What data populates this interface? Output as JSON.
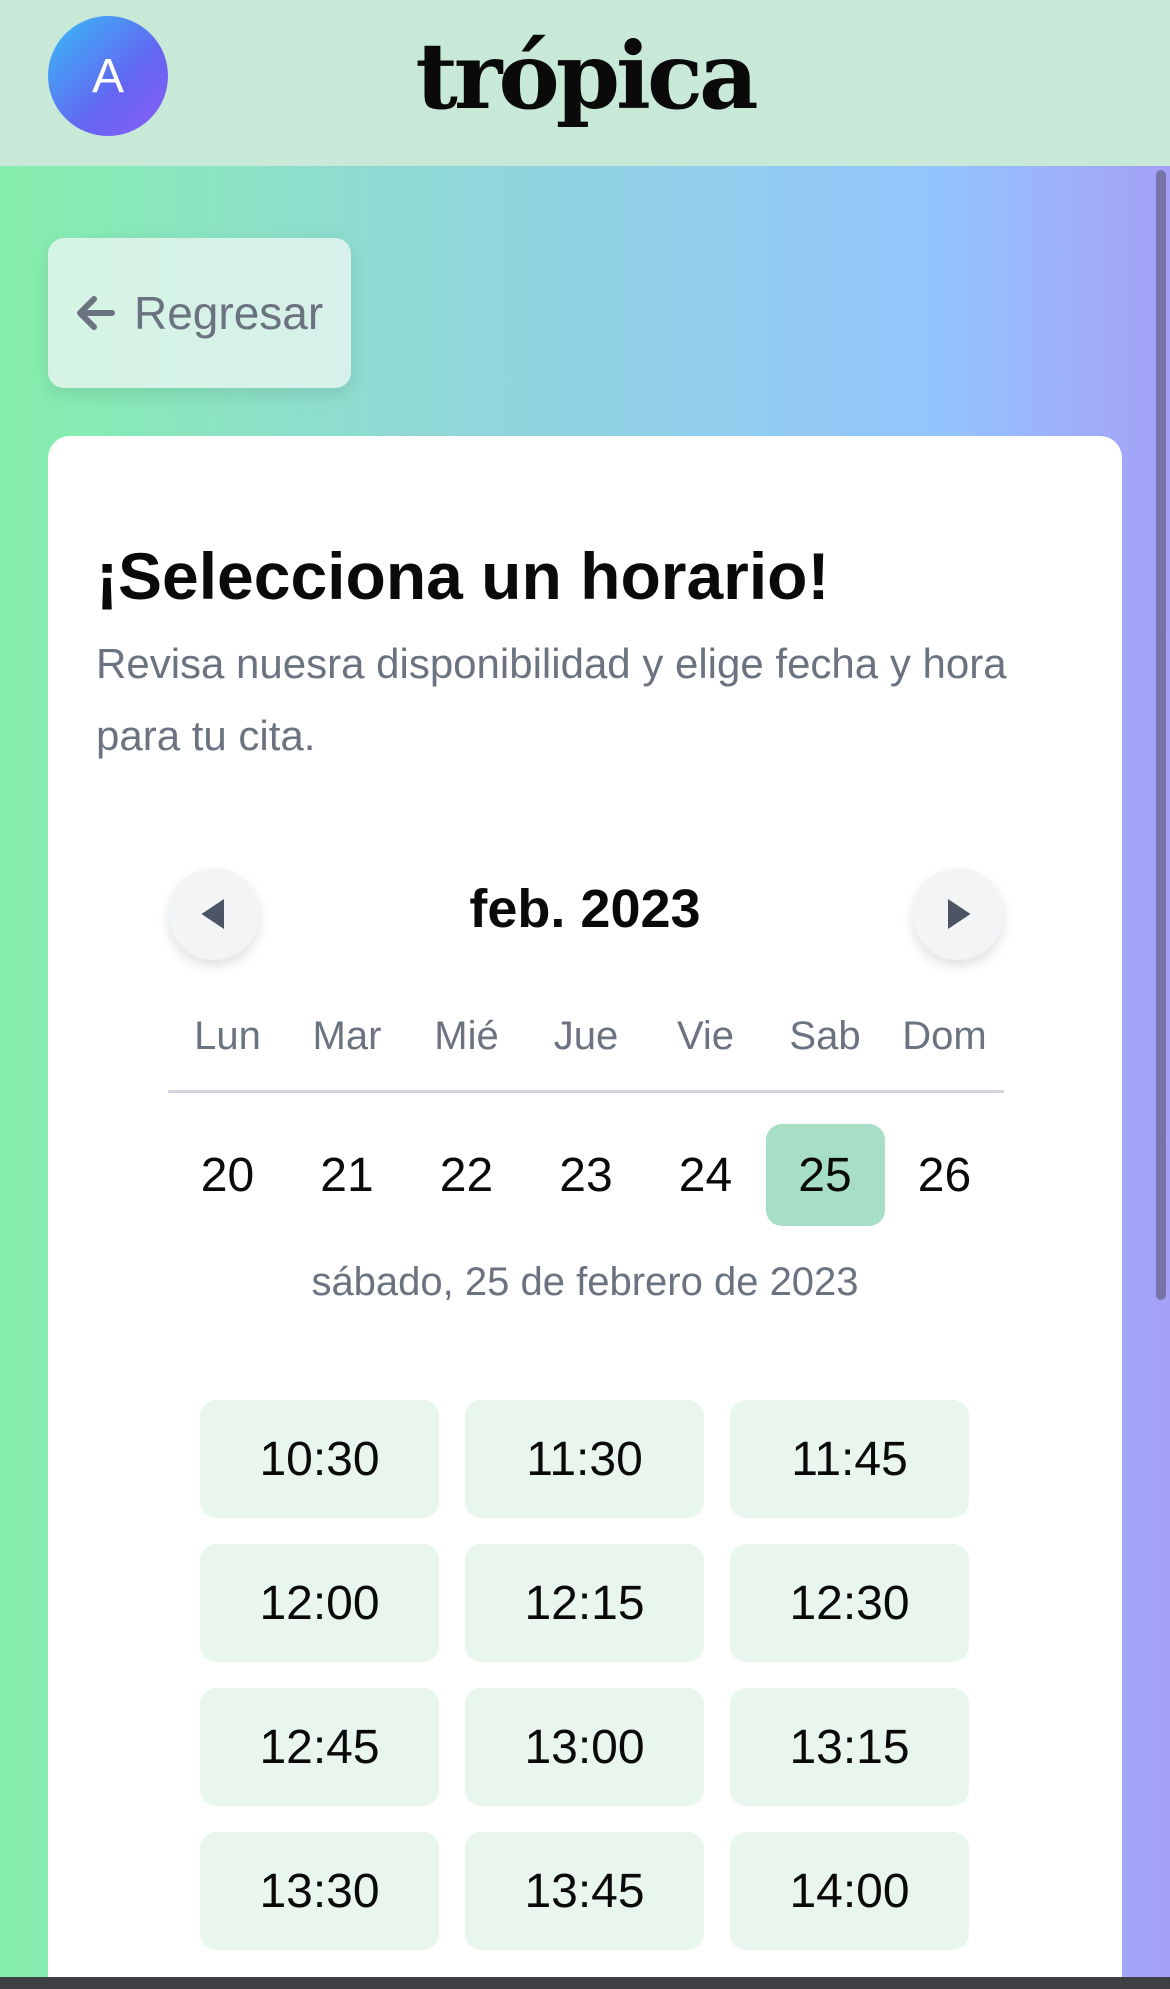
{
  "header": {
    "avatar_letter": "A",
    "logo": "trópica"
  },
  "back_button": {
    "label": "Regresar",
    "icon": "arrow-left-icon"
  },
  "scheduler": {
    "title": "¡Selecciona un horario!",
    "subtitle": "Revisa nuesra disponibilidad y elige fecha y hora para tu cita.",
    "month_label": "feb. 2023",
    "weekdays": [
      "Lun",
      "Mar",
      "Mié",
      "Jue",
      "Vie",
      "Sab",
      "Dom"
    ],
    "days": [
      "20",
      "21",
      "22",
      "23",
      "24",
      "25",
      "26"
    ],
    "selected_day": "25",
    "selected_date_label": "sábado, 25 de febrero de 2023",
    "time_slots": [
      "10:30",
      "11:30",
      "11:45",
      "12:00",
      "12:15",
      "12:30",
      "12:45",
      "13:00",
      "13:15",
      "13:30",
      "13:45",
      "14:00"
    ]
  },
  "colors": {
    "header_bg": "#c8e9d8",
    "selected_day_bg": "#a7dfc6",
    "slot_bg": "#e8f6ee",
    "muted_text": "#6b7280"
  }
}
